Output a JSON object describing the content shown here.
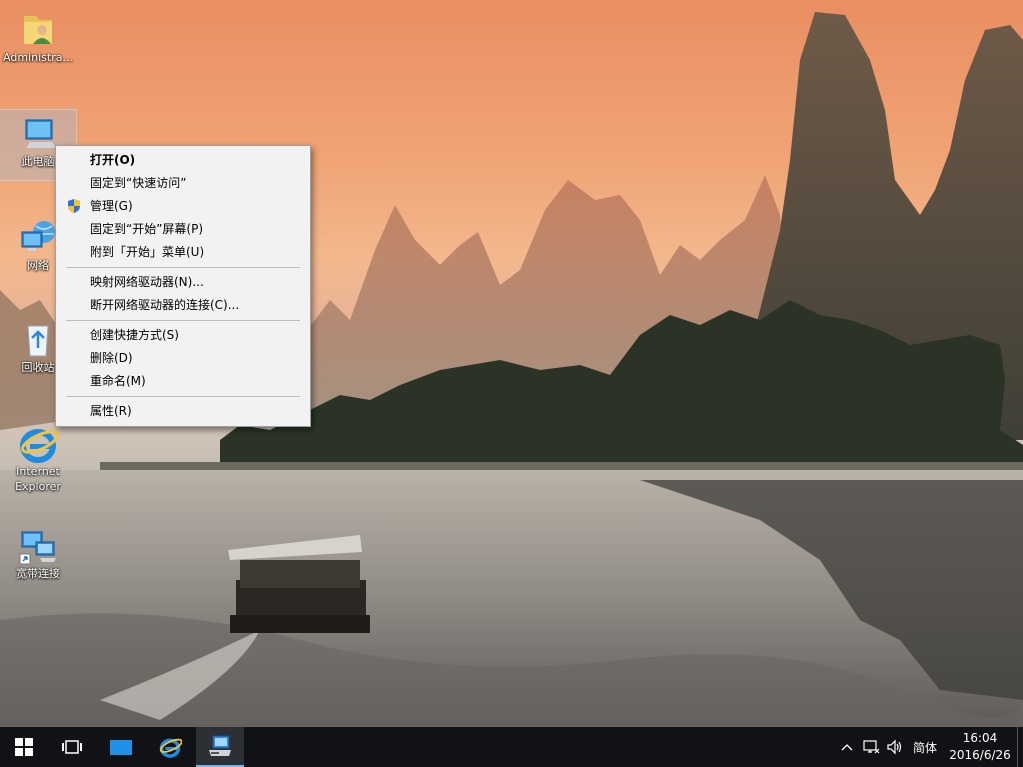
{
  "desktop": {
    "icons": [
      {
        "label": "Administra..."
      },
      {
        "label": "此电脑"
      },
      {
        "label": "网络"
      },
      {
        "label": "回收站"
      },
      {
        "label": "Internet Explorer"
      },
      {
        "label": "宽带连接"
      }
    ]
  },
  "context_menu": {
    "items": [
      {
        "label": "打开(O)",
        "bold": true
      },
      {
        "label": "固定到“快速访问”"
      },
      {
        "label": "管理(G)",
        "icon": "uac-shield-icon"
      },
      {
        "label": "固定到“开始”屏幕(P)"
      },
      {
        "label": "附到「开始」菜单(U)"
      },
      {
        "label": "映射网络驱动器(N)..."
      },
      {
        "label": "断开网络驱动器的连接(C)..."
      },
      {
        "label": "创建快捷方式(S)"
      },
      {
        "label": "删除(D)"
      },
      {
        "label": "重命名(M)"
      },
      {
        "label": "属性(R)"
      }
    ]
  },
  "taskbar": {
    "buttons": [
      "start-icon",
      "task-view-icon",
      "file-explorer-icon",
      "internet-explorer-icon",
      "computer-app-icon"
    ],
    "tray": {
      "language": "简体",
      "time": "16:04",
      "date": "2016/6/26"
    }
  },
  "colors": {
    "taskbar": "#101215",
    "menu_bg": "#f2f2f2",
    "accent": "#7fb2e5"
  }
}
